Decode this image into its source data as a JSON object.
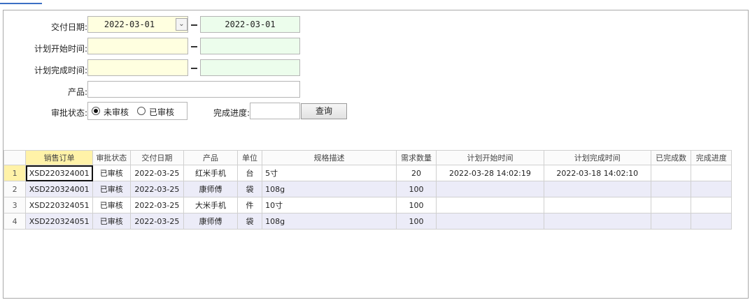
{
  "filters": {
    "delivery_date_label": "交付日期:",
    "delivery_date_from": "2022-03-01",
    "delivery_date_to": "2022-03-01",
    "plan_start_label": "计划开始时间:",
    "plan_start_from": "",
    "plan_start_to": "",
    "plan_finish_label": "计划完成时间:",
    "plan_finish_from": "",
    "plan_finish_to": "",
    "product_label": "产品:",
    "product_value": "",
    "approval_label": "审批状态:",
    "approval_options": [
      "未审核",
      "已审核"
    ],
    "approval_selected": "未审核",
    "progress_label": "完成进度:",
    "progress_value": "",
    "query_button": "查询",
    "dash": "—"
  },
  "grid": {
    "columns": [
      "销售订单",
      "审批状态",
      "交付日期",
      "产品",
      "单位",
      "规格描述",
      "需求数量",
      "计划开始时间",
      "计划完成时间",
      "已完成数",
      "完成进度"
    ],
    "rows": [
      {
        "num": "1",
        "order": "XSD220324001",
        "status": "已审核",
        "date": "2022-03-25",
        "product": "红米手机",
        "unit": "台",
        "spec": "5寸",
        "qty": "20",
        "start": "2022-03-28 14:02:19",
        "finish": "2022-03-18 14:02:10",
        "done": "",
        "progress": ""
      },
      {
        "num": "2",
        "order": "XSD220324001",
        "status": "已审核",
        "date": "2022-03-25",
        "product": "康师傅",
        "unit": "袋",
        "spec": "108g",
        "qty": "100",
        "start": "",
        "finish": "",
        "done": "",
        "progress": ""
      },
      {
        "num": "3",
        "order": "XSD220324051",
        "status": "已审核",
        "date": "2022-03-25",
        "product": "大米手机",
        "unit": "件",
        "spec": "10寸",
        "qty": "100",
        "start": "",
        "finish": "",
        "done": "",
        "progress": ""
      },
      {
        "num": "4",
        "order": "XSD220324051",
        "status": "已审核",
        "date": "2022-03-25",
        "product": "康师傅",
        "unit": "袋",
        "spec": "108g",
        "qty": "100",
        "start": "",
        "finish": "",
        "done": "",
        "progress": ""
      }
    ]
  },
  "icons": {
    "dropdown": "chevron-down-icon"
  }
}
